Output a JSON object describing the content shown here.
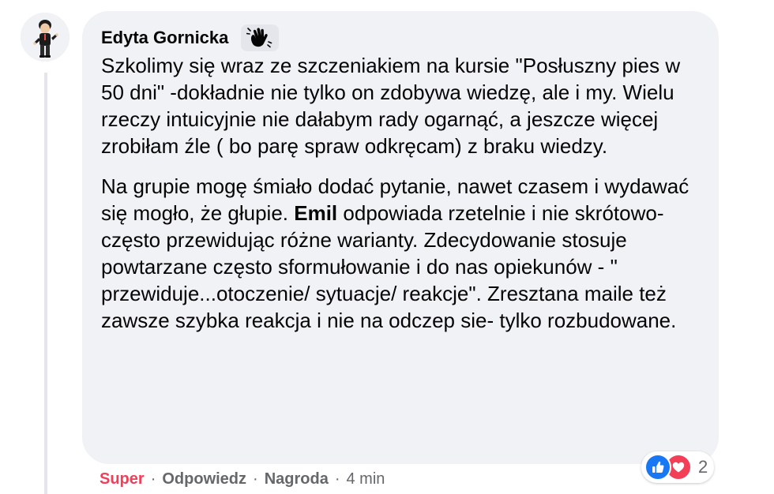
{
  "comment": {
    "author": "Edyta Gornicka",
    "paragraphs": [
      {
        "text": "Szkolimy się wraz ze szczeniakiem na kursie \"Posłuszny pies w 50 dni\" -dokładnie nie tylko on zdobywa wiedzę, ale i my. Wielu rzeczy intuicyjnie nie dałabym rady ogarnąć, a jeszcze więcej zrobiłam źle ( bo parę spraw odkręcam) z braku wiedzy."
      },
      {
        "before": "Na grupie mogę śmiało dodać pytanie, nawet czasem i wydawać się mogło, że głupie. ",
        "mention": "Emil",
        "after": " odpowiada rzetelnie i nie skrótowo- często przewidując różne warianty. Zdecydowanie stosuje powtarzane często sformułowanie i do nas opiekunów - \" przewiduje...otoczenie/ sytuacje/ reakcje\". Zresztana maile też zawsze szybka reakcja i nie na odczep sie- tylko rozbudowane."
      }
    ]
  },
  "reactions": {
    "types": [
      "like",
      "love"
    ],
    "count": "2"
  },
  "actions": {
    "react_label": "Super",
    "reply_label": "Odpowiedz",
    "award_label": "Nagroda",
    "separator": "·",
    "time": "4 min"
  },
  "colors": {
    "bubble": "#f0f2f5",
    "text": "#050505",
    "muted": "#65676b",
    "like": "#1877f2",
    "love": "#f33e58"
  }
}
